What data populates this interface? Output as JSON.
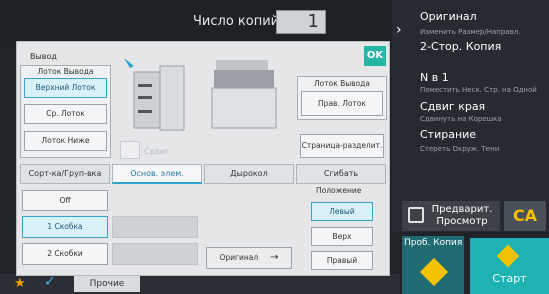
{
  "header": {
    "copies_label": "Число копий",
    "copies_value": "1"
  },
  "right_panel": {
    "items": [
      {
        "title": "Оригинал",
        "sub": "Изменить Размер/Направл."
      },
      {
        "title": "2-Стор. Копия",
        "sub": ""
      },
      {
        "title": "N в 1",
        "sub": "Поместить Неск. Стр. на Одной"
      },
      {
        "title": "Сдвиг края",
        "sub": "Сдвинуть на Корешка"
      },
      {
        "title": "Стирание",
        "sub": "Стереть Окруж. Тени"
      }
    ],
    "preview_label": "Предварит. Просмотр",
    "ca_label": "CA",
    "proof_label": "Проб. Копия",
    "start_label": "Старт"
  },
  "bottom": {
    "other_label": "Прочие"
  },
  "dialog": {
    "title": "Вывод",
    "ok_label": "OK",
    "output_tray_left": {
      "label": "Лоток Вывода",
      "options": [
        "Верхний Лоток",
        "Ср. Лоток",
        "Лоток Ниже"
      ],
      "selected": "Верхний Лоток"
    },
    "output_tray_right": {
      "label": "Лоток Вывода",
      "button": "Прав. Лоток"
    },
    "shift_label": "Сдвиг",
    "page_separator": "Страница-разделит.",
    "tabs": [
      "Сорт-ка/Груп-вка",
      "Основ. элем.",
      "Дырокол",
      "Сгибать"
    ],
    "active_tab": "Основ. элем.",
    "staple": {
      "off": "Off",
      "one": "1 Скобка",
      "two": "2 Скобки",
      "selected": "1 Скобка"
    },
    "original_label": "Оригинал",
    "position": {
      "label": "Положение",
      "options": [
        "Левый",
        "Верх",
        "Правый"
      ],
      "selected": "Левый"
    }
  }
}
